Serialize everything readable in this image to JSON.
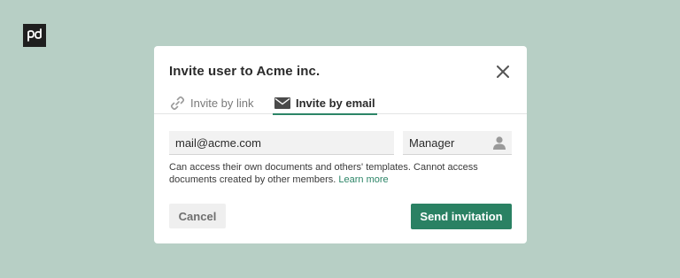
{
  "brand": {
    "logo_icon": "pandadoc-logo-icon"
  },
  "modal": {
    "title": "Invite user to Acme inc.",
    "close_icon": "close-icon"
  },
  "tabs": [
    {
      "label": "Invite by link",
      "icon": "link-icon",
      "active": false
    },
    {
      "label": "Invite by email",
      "icon": "envelope-icon",
      "active": true
    }
  ],
  "form": {
    "email_value": "mail@acme.com",
    "role_value": "Manager",
    "role_icon": "person-icon",
    "help_text": "Can access their own documents and others' templates. Cannot access documents created by other members.",
    "learn_more": "Learn more"
  },
  "actions": {
    "cancel_label": "Cancel",
    "send_label": "Send invitation"
  },
  "colors": {
    "background": "#b7cfc5",
    "accent": "#2a8163",
    "modal": "#ffffff"
  }
}
